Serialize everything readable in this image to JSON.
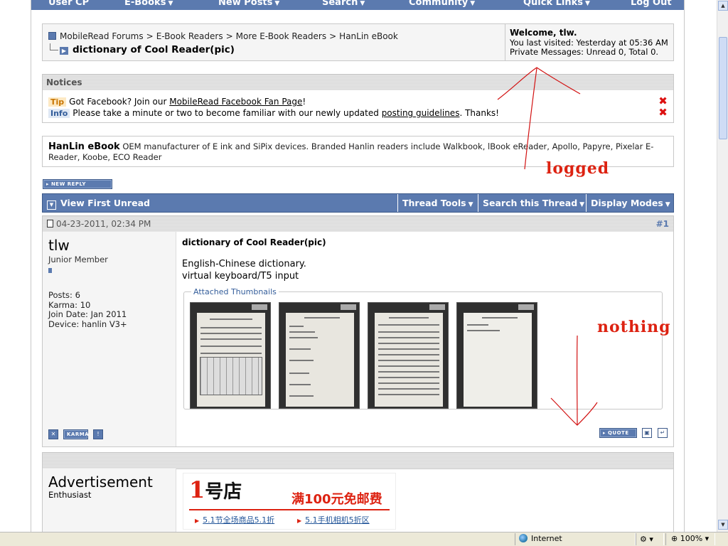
{
  "topnav": {
    "items": [
      "User CP",
      "E-Books",
      "New Posts",
      "Search",
      "Community",
      "Quick Links",
      "Log Out"
    ]
  },
  "breadcrumb": {
    "path": [
      "MobileRead Forums",
      "E-Book Readers",
      "More E-Book Readers",
      "HanLin eBook"
    ],
    "separator": ">",
    "thread_title": "dictionary of Cool Reader(pic)"
  },
  "welcome": {
    "greeting": "Welcome, tlw.",
    "last_visited": "You last visited: Yesterday at 05:36 AM",
    "private_messages": "Private Messages: Unread 0, Total 0."
  },
  "notices": {
    "title": "Notices",
    "items": [
      {
        "tag": "Tip",
        "before": "Got Facebook? Join our ",
        "link": "MobileRead Facebook Fan Page",
        "after": "!"
      },
      {
        "tag": "Info",
        "before": "Please take a minute or two to become familiar with our newly updated ",
        "link": "posting guidelines",
        "after": ". Thanks!"
      }
    ],
    "close_glyph": "✖"
  },
  "forum_description": {
    "name": "HanLin eBook",
    "text": " OEM manufacturer of E ink and SiPix devices. Branded Hanlin readers include Walkbook, lBook eReader, Apollo, Papyre, Pixelar E-Reader, Koobe, ECO Reader"
  },
  "buttons": {
    "new_reply": "NEW REPLY",
    "karma": "KARMA",
    "quote": "QUOTE"
  },
  "threadbar": {
    "view_first_unread": "View First Unread",
    "thread_tools": "Thread Tools",
    "search_thread": "Search this Thread",
    "display_modes": "Display Modes"
  },
  "post": {
    "date": "04-23-2011, 02:34 PM",
    "number": "#1",
    "username": "tlw",
    "user_title": "Junior Member",
    "stats": [
      "Posts: 6",
      "Karma: 10",
      "Join Date: Jan 2011",
      "Device: hanlin V3+"
    ],
    "title": "dictionary of Cool Reader(pic)",
    "lines": [
      "English-Chinese dictionary.",
      "virtual keyboard/T5 input"
    ],
    "attachments_label": "Attached Thumbnails"
  },
  "advertisement": {
    "name": "Advertisement",
    "title": "Enthusiast",
    "banner": {
      "logo_num": "1",
      "logo_text": "号店",
      "headline": "满100元免邮费",
      "promo1": "5.1节全场商品5.1折",
      "promo2": "5.1手机相机5折区"
    }
  },
  "annotations": {
    "logged": "logged",
    "nothing": "nothing",
    "color": "#d21111"
  },
  "statusbar": {
    "zone": "Internet",
    "zoom": "100%"
  }
}
